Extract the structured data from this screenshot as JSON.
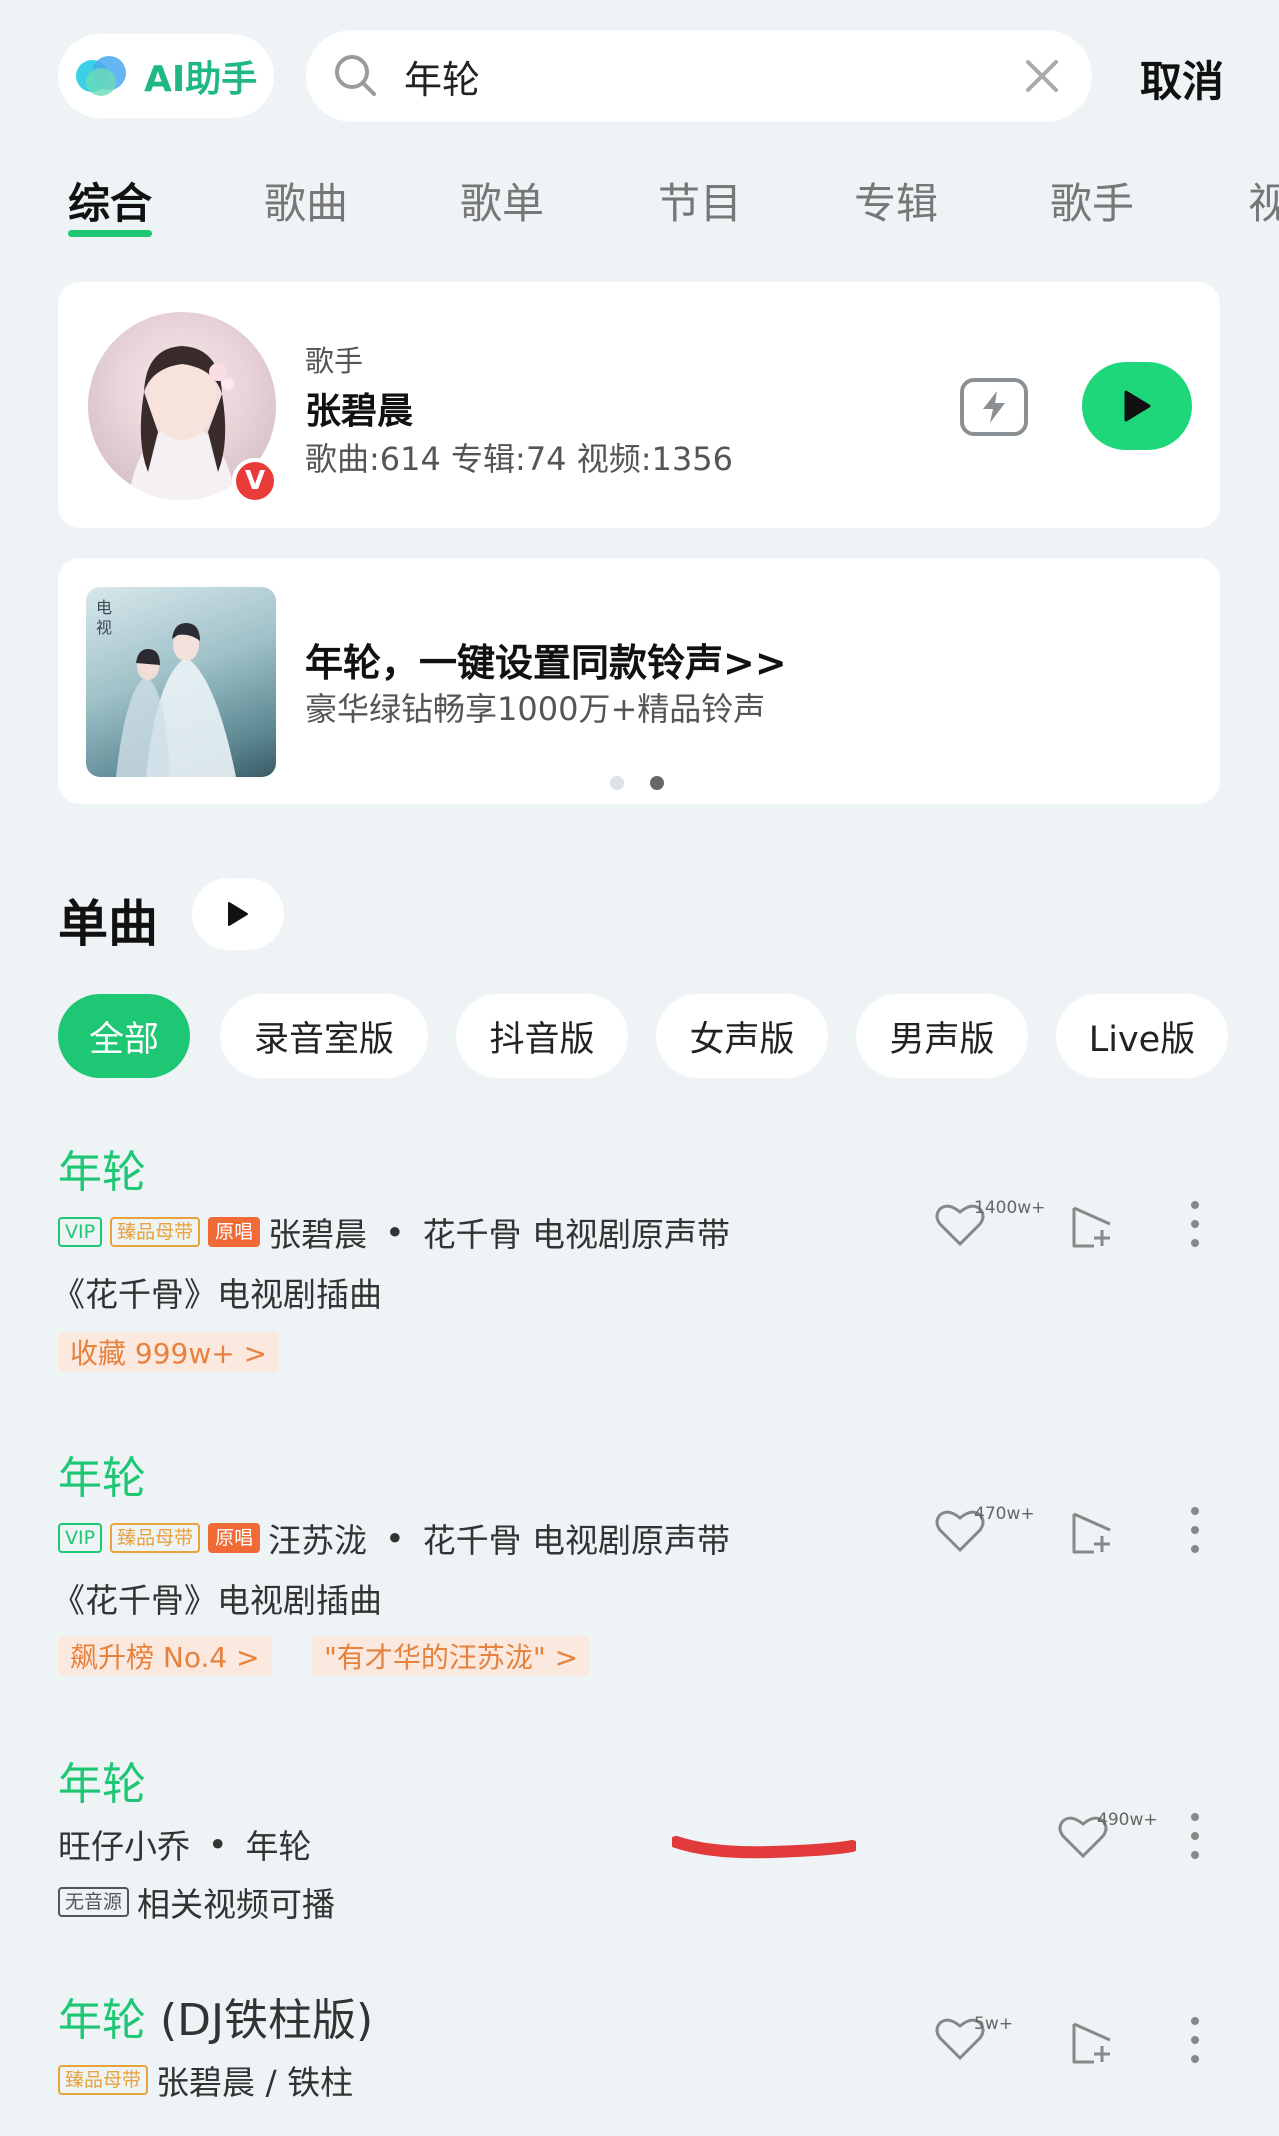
{
  "header": {
    "ai_label": "AI助手",
    "search_value": "年轮",
    "cancel_label": "取消"
  },
  "tabs": [
    "综合",
    "歌曲",
    "歌单",
    "节目",
    "专辑",
    "歌手",
    "视"
  ],
  "artist_card": {
    "tag": "歌手",
    "name": "张碧晨",
    "stats": "歌曲:614 专辑:74 视频:1356",
    "badge": "V"
  },
  "ring_card": {
    "title": "年轮，一键设置同款铃声>>",
    "subtitle": "豪华绿钻畅享1000万+精品铃声"
  },
  "singles": {
    "title": "单曲",
    "filters": [
      "全部",
      "录音室版",
      "抖音版",
      "女声版",
      "男声版",
      "Live版"
    ]
  },
  "songs": [
    {
      "title": "年轮",
      "tags": [
        "VIP",
        "臻品母带",
        "原唱"
      ],
      "artist": "张碧晨",
      "album": "花千骨 电视剧原声带",
      "desc": "《花千骨》电视剧插曲",
      "pills": [
        "收藏 999w+ >"
      ],
      "likes": "1400w+"
    },
    {
      "title": "年轮",
      "tags": [
        "VIP",
        "臻品母带",
        "原唱"
      ],
      "artist": "汪苏泷",
      "album": "花千骨 电视剧原声带",
      "desc": "《花千骨》电视剧插曲",
      "pills": [
        "飙升榜 No.4 >",
        "\"有才华的汪苏泷\" >"
      ],
      "likes": "470w+"
    },
    {
      "title": "年轮",
      "artist": "旺仔小乔",
      "album": "年轮",
      "tags": [
        "无音源"
      ],
      "desc": "相关视频可播",
      "likes": "490w+"
    },
    {
      "title": "年轮",
      "title_extra": " (DJ铁柱版)",
      "tags": [
        "臻品母带"
      ],
      "artist": "张碧晨 / 铁柱",
      "likes": "5w+"
    }
  ],
  "colors": {
    "accent": "#1ec774",
    "background": "#eef3f5",
    "orange": "#e7813e"
  }
}
